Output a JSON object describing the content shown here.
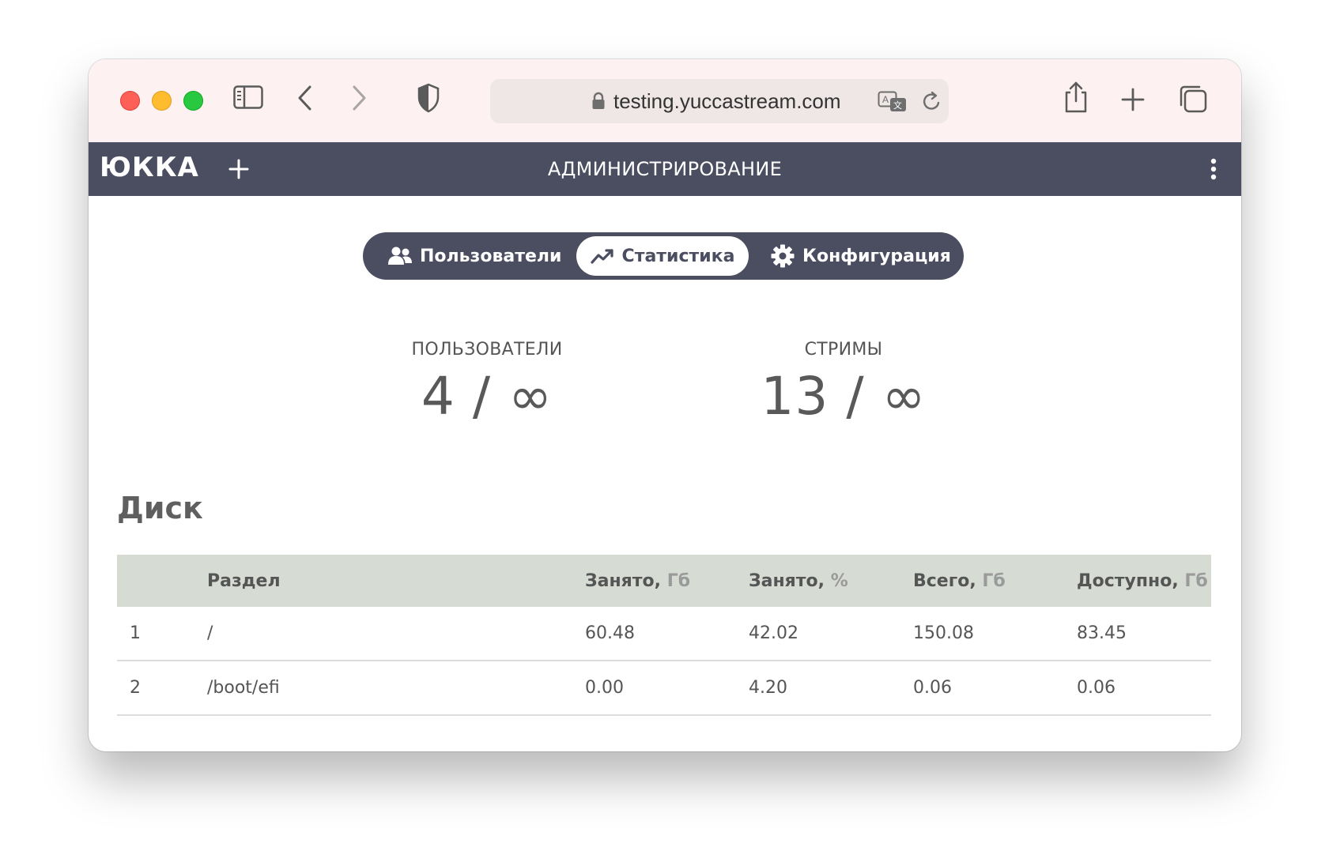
{
  "browser": {
    "url": "testing.yuccastream.com"
  },
  "header": {
    "logo": "ЮККА",
    "title": "АДМИНИСТРИРОВАНИЕ"
  },
  "tabs": [
    {
      "label": "Пользователи",
      "icon": "users-icon",
      "active": false
    },
    {
      "label": "Статистика",
      "icon": "chart-line-icon",
      "active": true
    },
    {
      "label": "Конфигурация",
      "icon": "gear-icon",
      "active": false
    }
  ],
  "stats": {
    "users": {
      "label": "ПОЛЬЗОВАТЕЛИ",
      "value": "4 / ∞"
    },
    "streams": {
      "label": "СТРИМЫ",
      "value": "13 / ∞"
    }
  },
  "disk": {
    "title": "Диск",
    "columns": [
      {
        "label": "",
        "unit": ""
      },
      {
        "label": "Раздел",
        "unit": ""
      },
      {
        "label": "Занято,",
        "unit": " Гб"
      },
      {
        "label": "Занято,",
        "unit": " %"
      },
      {
        "label": "Всего,",
        "unit": " Гб"
      },
      {
        "label": "Доступно,",
        "unit": " Гб"
      }
    ],
    "rows": [
      {
        "index": "1",
        "partition": "/",
        "used_gb": "60.48",
        "used_pct": "42.02",
        "total_gb": "150.08",
        "available_gb": "83.45"
      },
      {
        "index": "2",
        "partition": "/boot/efi",
        "used_gb": "0.00",
        "used_pct": "4.20",
        "total_gb": "0.06",
        "available_gb": "0.06"
      }
    ]
  },
  "colors": {
    "header_bg": "#4b4d61",
    "toolbar_bg": "#fdf1f1",
    "table_header_bg": "#d6dcd3"
  }
}
